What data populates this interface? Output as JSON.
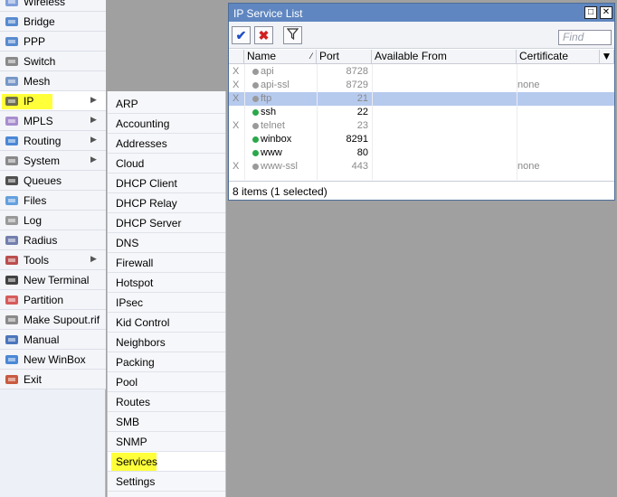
{
  "sidebar": {
    "items": [
      {
        "label": "Wireless",
        "icon": "wireless-icon",
        "arrow": false
      },
      {
        "label": "Bridge",
        "icon": "bridge-icon",
        "arrow": false
      },
      {
        "label": "PPP",
        "icon": "ppp-icon",
        "arrow": false
      },
      {
        "label": "Switch",
        "icon": "switch-icon",
        "arrow": false
      },
      {
        "label": "Mesh",
        "icon": "mesh-icon",
        "arrow": false
      },
      {
        "label": "IP",
        "icon": "ip-icon",
        "arrow": true
      },
      {
        "label": "MPLS",
        "icon": "mpls-icon",
        "arrow": true
      },
      {
        "label": "Routing",
        "icon": "routing-icon",
        "arrow": true
      },
      {
        "label": "System",
        "icon": "gear-icon",
        "arrow": true
      },
      {
        "label": "Queues",
        "icon": "queues-icon",
        "arrow": false
      },
      {
        "label": "Files",
        "icon": "folder-icon",
        "arrow": false
      },
      {
        "label": "Log",
        "icon": "log-icon",
        "arrow": false
      },
      {
        "label": "Radius",
        "icon": "radius-icon",
        "arrow": false
      },
      {
        "label": "Tools",
        "icon": "tools-icon",
        "arrow": true
      },
      {
        "label": "New Terminal",
        "icon": "terminal-icon",
        "arrow": false
      },
      {
        "label": "Partition",
        "icon": "partition-icon",
        "arrow": false
      },
      {
        "label": "Make Supout.rif",
        "icon": "document-icon",
        "arrow": false
      },
      {
        "label": "Manual",
        "icon": "help-icon",
        "arrow": false
      },
      {
        "label": "New WinBox",
        "icon": "winbox-icon",
        "arrow": false
      },
      {
        "label": "Exit",
        "icon": "exit-icon",
        "arrow": false
      }
    ]
  },
  "submenu": {
    "items": [
      "ARP",
      "Accounting",
      "Addresses",
      "Cloud",
      "DHCP Client",
      "DHCP Relay",
      "DHCP Server",
      "DNS",
      "Firewall",
      "Hotspot",
      "IPsec",
      "Kid Control",
      "Neighbors",
      "Packing",
      "Pool",
      "Routes",
      "SMB",
      "SNMP",
      "Services",
      "Settings"
    ]
  },
  "window": {
    "title": "IP Service List",
    "find_placeholder": "Find",
    "columns": [
      "Name",
      "Port",
      "Available From",
      "Certificate"
    ],
    "rows": [
      {
        "flag": "X",
        "name": "api",
        "port": "8728",
        "certificate": "",
        "disabled": true,
        "selected": false
      },
      {
        "flag": "X",
        "name": "api-ssl",
        "port": "8729",
        "certificate": "none",
        "disabled": true,
        "selected": false
      },
      {
        "flag": "X",
        "name": "ftp",
        "port": "21",
        "certificate": "",
        "disabled": true,
        "selected": true
      },
      {
        "flag": "",
        "name": "ssh",
        "port": "22",
        "certificate": "",
        "disabled": false,
        "selected": false
      },
      {
        "flag": "X",
        "name": "telnet",
        "port": "23",
        "certificate": "",
        "disabled": true,
        "selected": false
      },
      {
        "flag": "",
        "name": "winbox",
        "port": "8291",
        "certificate": "",
        "disabled": false,
        "selected": false
      },
      {
        "flag": "",
        "name": "www",
        "port": "80",
        "certificate": "",
        "disabled": false,
        "selected": false
      },
      {
        "flag": "X",
        "name": "www-ssl",
        "port": "443",
        "certificate": "none",
        "disabled": true,
        "selected": false
      }
    ],
    "status": "8 items (1 selected)"
  },
  "colors": {
    "highlight": "#ffff3a",
    "titlebar": "#5f86c0",
    "selected_row": "#b6caee",
    "enabled_dot": "#2aa84a",
    "disabled_dot": "#9a9a9a"
  }
}
